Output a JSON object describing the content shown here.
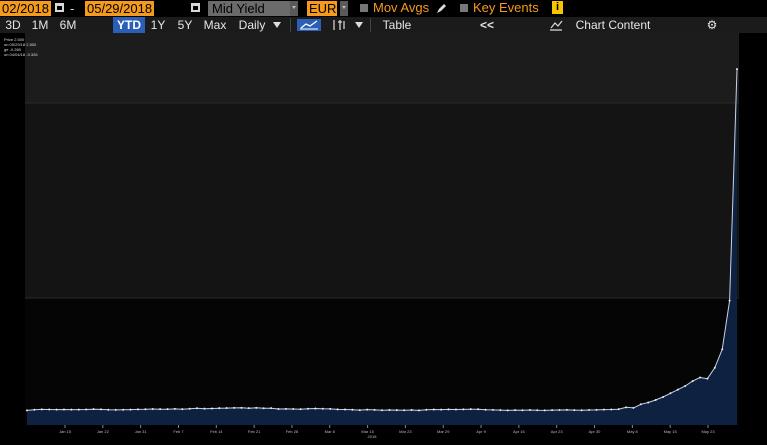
{
  "toolbar": {
    "start_date": "02/2018",
    "dash": "-",
    "end_date": "05/29/2018",
    "field": "Mid Yield",
    "currency": "EUR",
    "mov_avgs": "Mov Avgs",
    "key_events": "Key Events",
    "info_glyph": "i"
  },
  "range_bar": {
    "periods": [
      "3D",
      "1M",
      "6M",
      "YTD",
      "1Y",
      "5Y",
      "Max"
    ],
    "active": "YTD",
    "frequency": "Daily",
    "table": "Table",
    "collapse": "<<",
    "chart_content": "Chart Content",
    "settings_glyph": "⚙"
  },
  "legend": {
    "lines": [
      "Price 2.500",
      "on 05/29/18 2.500",
      "ge -0.265",
      "on 04/04/18 -0.326"
    ]
  },
  "colors": {
    "accent_orange": "#f59a1b",
    "active_blue": "#2b5fb5",
    "line": "#c9d3e6",
    "area": "#0e2140"
  },
  "chart_data": {
    "type": "area",
    "x_ticks": [
      "Jan 15",
      "Jan 22",
      "Jan 31",
      "Feb 7",
      "Feb 14",
      "Feb 21",
      "Feb 28",
      "Mar 8",
      "Mar 15",
      "Mar 23",
      "Mar 29",
      "Apr 9",
      "Apr 16",
      "Apr 23",
      "Apr 30",
      "May 8",
      "May 15",
      "May 23"
    ],
    "year_label": "2018",
    "values": [
      -0.3,
      -0.295,
      -0.292,
      -0.293,
      -0.294,
      -0.293,
      -0.294,
      -0.294,
      -0.293,
      -0.29,
      -0.292,
      -0.295,
      -0.296,
      -0.295,
      -0.294,
      -0.292,
      -0.291,
      -0.289,
      -0.29,
      -0.29,
      -0.288,
      -0.29,
      -0.287,
      -0.283,
      -0.286,
      -0.285,
      -0.282,
      -0.281,
      -0.28,
      -0.279,
      -0.282,
      -0.279,
      -0.283,
      -0.282,
      -0.289,
      -0.288,
      -0.289,
      -0.29,
      -0.287,
      -0.285,
      -0.287,
      -0.288,
      -0.292,
      -0.293,
      -0.295,
      -0.298,
      -0.294,
      -0.296,
      -0.299,
      -0.297,
      -0.298,
      -0.299,
      -0.297,
      -0.3,
      -0.295,
      -0.293,
      -0.294,
      -0.292,
      -0.293,
      -0.292,
      -0.29,
      -0.291,
      -0.295,
      -0.296,
      -0.298,
      -0.3,
      -0.298,
      -0.299,
      -0.297,
      -0.299,
      -0.3,
      -0.298,
      -0.297,
      -0.296,
      -0.298,
      -0.299,
      -0.297,
      -0.296,
      -0.294,
      -0.293,
      -0.29,
      -0.275,
      -0.28,
      -0.25,
      -0.235,
      -0.215,
      -0.19,
      -0.16,
      -0.13,
      -0.1,
      -0.06,
      -0.03,
      -0.04,
      0.05,
      0.2,
      0.6,
      2.5
    ],
    "ylim": [
      -0.42,
      2.55
    ]
  }
}
